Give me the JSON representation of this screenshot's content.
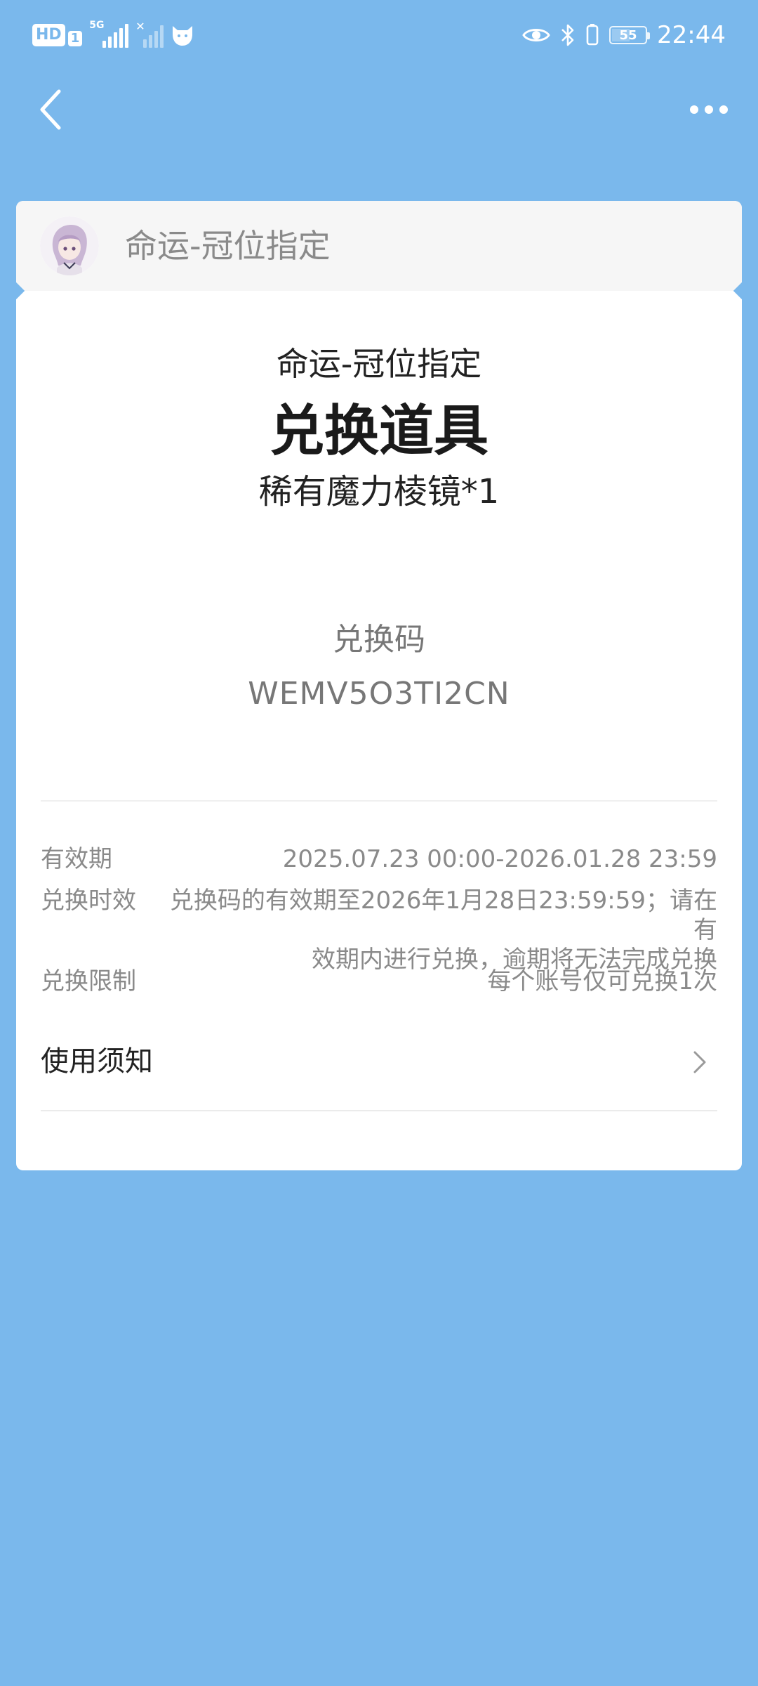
{
  "status_bar": {
    "hd_label": "HD",
    "hd_sim": "1",
    "network_label": "5G",
    "battery_level": "55",
    "battery_fraction": 0.55,
    "time": "22:44",
    "icons": [
      "hd-icon",
      "signal-icon",
      "no-signal-icon",
      "cat-icon",
      "eye-icon",
      "bluetooth-icon",
      "vibrate-icon",
      "battery-icon"
    ]
  },
  "nav": {
    "back_icon": "chevron-left-icon",
    "more_icon": "more-dots-icon"
  },
  "card": {
    "header_title": "命运-冠位指定",
    "game_name": "命运-冠位指定",
    "redeem_type": "兑换道具",
    "item_name": "稀有魔力棱镜*1",
    "code_label": "兑换码",
    "code_value": "WEMV5O3TI2CN"
  },
  "info": {
    "validity_label": "有效期",
    "validity_value": "2025.07.23 00:00-2026.01.28 23:59",
    "timeliness_label": "兑换时效",
    "timeliness_line1": "兑换码的有效期至2026年1月28日23:59:59；请在有",
    "timeliness_line2": "效期内进行兑换，逾期将无法完成兑换",
    "limit_label": "兑换限制",
    "limit_value": "每个账号仅可兑换1次"
  },
  "notice": {
    "label": "使用须知"
  },
  "colors": {
    "background": "#7ab8ec",
    "card": "#ffffff",
    "header_bg": "#f6f6f6"
  }
}
